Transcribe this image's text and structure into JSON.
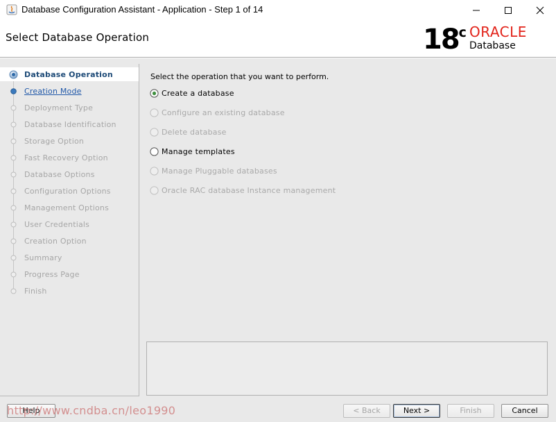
{
  "window": {
    "title": "Database Configuration Assistant - Application - Step 1 of 14",
    "app_icon": "java-icon",
    "controls": [
      "minimize-icon",
      "maximize-icon",
      "close-icon"
    ]
  },
  "header": {
    "page_title": "Select Database Operation",
    "logo": {
      "version": "18",
      "version_suffix": "c",
      "brand": "ORACLE",
      "product": "Database",
      "brand_color": "#e2231a"
    }
  },
  "sidebar": {
    "steps": [
      {
        "label": "Database Operation",
        "state": "active"
      },
      {
        "label": "Creation Mode",
        "state": "link"
      },
      {
        "label": "Deployment Type",
        "state": "disabled"
      },
      {
        "label": "Database Identification",
        "state": "disabled"
      },
      {
        "label": "Storage Option",
        "state": "disabled"
      },
      {
        "label": "Fast Recovery Option",
        "state": "disabled"
      },
      {
        "label": "Database Options",
        "state": "disabled"
      },
      {
        "label": "Configuration Options",
        "state": "disabled"
      },
      {
        "label": "Management Options",
        "state": "disabled"
      },
      {
        "label": "User Credentials",
        "state": "disabled"
      },
      {
        "label": "Creation Option",
        "state": "disabled"
      },
      {
        "label": "Summary",
        "state": "disabled"
      },
      {
        "label": "Progress Page",
        "state": "disabled"
      },
      {
        "label": "Finish",
        "state": "disabled"
      }
    ]
  },
  "content": {
    "prompt": "Select the operation that you want to perform.",
    "options": [
      {
        "label": "Create a database",
        "selected": true,
        "enabled": true
      },
      {
        "label": "Configure an existing database",
        "selected": false,
        "enabled": false
      },
      {
        "label": "Delete database",
        "selected": false,
        "enabled": false
      },
      {
        "label": "Manage templates",
        "selected": false,
        "enabled": true
      },
      {
        "label": "Manage Pluggable databases",
        "selected": false,
        "enabled": false
      },
      {
        "label": "Oracle RAC database Instance management",
        "selected": false,
        "enabled": false
      }
    ]
  },
  "footer": {
    "help": "Help",
    "back": "< Back",
    "next": "Next >",
    "finish": "Finish",
    "cancel": "Cancel"
  },
  "watermark": "http://www.cndba.cn/leo1990"
}
